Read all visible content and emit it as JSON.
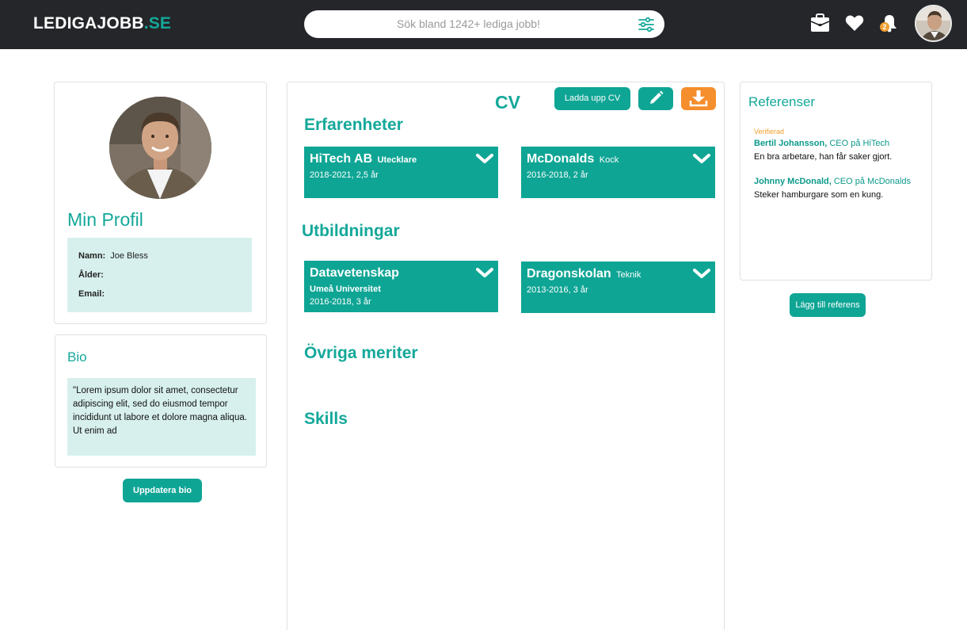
{
  "header": {
    "logo_main": "LEDIGAJOBB",
    "logo_suffix": ".SE",
    "search_placeholder": "Sök bland 1242+ lediga jobb!",
    "notification_count": "2",
    "icons": [
      "filter-icon",
      "briefcase-icon",
      "heart-icon",
      "bell-icon"
    ]
  },
  "profile": {
    "title": "Min Profil",
    "fields": [
      {
        "label": "Namn:",
        "value": "Joe Bless"
      },
      {
        "label": "Ålder:",
        "value": ""
      },
      {
        "label": "Email:",
        "value": ""
      }
    ]
  },
  "bio": {
    "title": "Bio",
    "text": "\"Lorem ipsum dolor sit amet, consectetur adipiscing elit, sed do eiusmod tempor incididunt ut labore et dolore magna aliqua. Ut enim ad",
    "button": "Uppdatera bio"
  },
  "cv": {
    "title": "CV",
    "upload_button": "Ladda upp CV",
    "experience_title": "Erfarenheter",
    "experience": [
      {
        "name": "HiTech AB",
        "role": "Utecklare",
        "dates": "2018-2021, 2,5 år"
      },
      {
        "name": "McDonalds",
        "role": "Kock",
        "dates": "2016-2018, 2 år"
      }
    ],
    "education_title": "Utbildningar",
    "education": [
      {
        "name": "Datavetenskap",
        "school": "Umeå Universitet",
        "dates": "2016-2018, 3 år"
      },
      {
        "name": "Dragonskolan",
        "role": "Teknik",
        "dates": "2013-2016, 3 år"
      }
    ],
    "other_title": "Övriga meriter",
    "skills_title": "Skills"
  },
  "references": {
    "title": "Referenser",
    "verified_label": "Verifierad",
    "items": [
      {
        "name": "Bertil Johansson,",
        "position": "CEO på HiTech",
        "text": "En bra arbetare, han får saker gjort."
      },
      {
        "name": "Johnny McDonald,",
        "position": "CEO på McDonalds",
        "text": "Steker hamburgare som en kung."
      }
    ],
    "add_button": "Lägg till referens"
  },
  "colors": {
    "header_bg": "#24262a",
    "accent": "#14a89a",
    "orange": "#f58e2c",
    "light_teal": "#d7f0ed"
  }
}
